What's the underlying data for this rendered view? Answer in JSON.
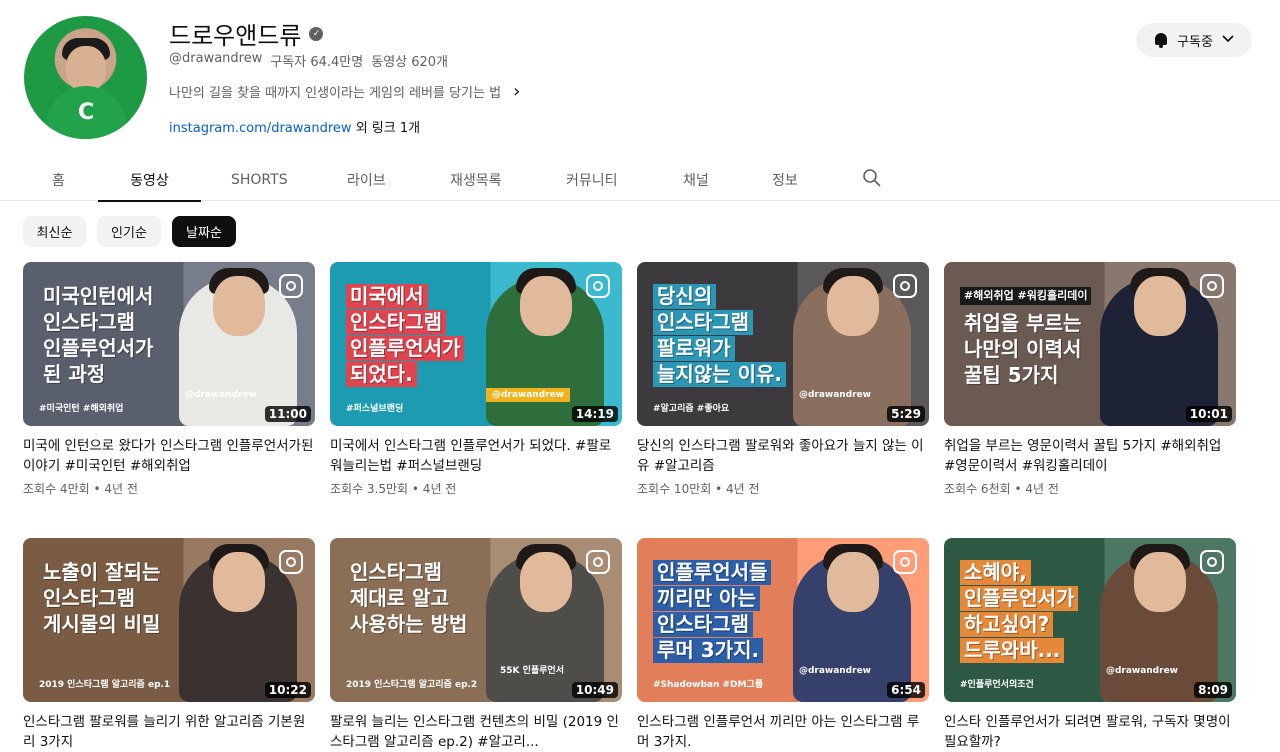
{
  "channel": {
    "name": "드로우앤드류",
    "handle": "@drawandrew",
    "subscribers": "구독자 64.4만명",
    "videos": "동영상 620개",
    "description": "나만의 길을 찾을 때까지 인생이라는 게임의 레버를 당기는 법",
    "link": "instagram.com/drawandrew",
    "link_more": "외 링크 1개",
    "avatar_text": "C",
    "subscribe_label": "구독중"
  },
  "tabs": [
    {
      "label": "홈"
    },
    {
      "label": "동영상"
    },
    {
      "label": "SHORTS"
    },
    {
      "label": "라이브"
    },
    {
      "label": "재생목록"
    },
    {
      "label": "커뮤니티"
    },
    {
      "label": "채널"
    },
    {
      "label": "정보"
    }
  ],
  "chips": [
    {
      "label": "최신순"
    },
    {
      "label": "인기순"
    },
    {
      "label": "날짜순"
    }
  ],
  "videos": [
    {
      "title": "미국에 인턴으로 왔다가 인스타그램 인플루언서가된 이야기 #미국인턴 #해외취업",
      "stats": "조회수 4만회 • 4년 전",
      "duration": "11:00",
      "lines": [
        "미국인턴에서",
        "인스타그램",
        "인플루언서가",
        "된 과정"
      ],
      "tag": "#미국인턴 #해외취업",
      "brand": "@drawandrew",
      "bg": "#5a5f6e",
      "hl": "transparent",
      "person": "#e8e8e4"
    },
    {
      "title": "미국에서 인스타그램 인플루언서가 되었다. #팔로워늘리는법 #퍼스널브랜딩",
      "stats": "조회수 3.5만회 • 4년 전",
      "duration": "14:19",
      "lines": [
        "미국에서",
        "인스타그램",
        "인플루언서가",
        "되었다."
      ],
      "tag": "#퍼스널브랜딩",
      "brand": "@drawandrew",
      "bg": "#1d9bb0",
      "hl": "#e0444f",
      "person": "#2d6e3a"
    },
    {
      "title": "당신의 인스타그램 팔로워와 좋아요가 늘지 않는 이유 #알고리즘",
      "stats": "조회수 10만회 • 4년 전",
      "duration": "5:29",
      "lines": [
        "당신의",
        "인스타그램",
        "팔로워가",
        "늘지않는 이유."
      ],
      "tag": "#알고리즘 #좋아요",
      "brand": "@drawandrew",
      "bg": "#3d3a3e",
      "hl": "#2b96b6",
      "person": "#8a6f5e"
    },
    {
      "title": "취업을 부르는 영문이력서 꿀팁 5가지 #해외취업 #영문이력서 #워킹홀리데이",
      "stats": "조회수 6천회 • 4년 전",
      "duration": "10:01",
      "lines": [
        "#해외취업 #워킹홀리데이",
        "취업을 부르는",
        "나만의 이력서",
        "꿀팁 5가지"
      ],
      "tag": "",
      "brand": "",
      "bg": "#6b5a52",
      "hl": "transparent",
      "person": "#1d2236"
    },
    {
      "title": "인스타그램 팔로워를 늘리기 위한 알고리즘 기본원리 3가지",
      "stats": "",
      "duration": "10:22",
      "lines": [
        "노출이 잘되는",
        "인스타그램",
        "게시물의 비밀"
      ],
      "tag": "2019 인스타그램 알고리즘 ep.1",
      "brand": "",
      "bg": "#7a5c44",
      "hl": "transparent",
      "person": "#3a3230"
    },
    {
      "title": "팔로워 늘리는 인스타그램 컨텐츠의 비밀 (2019 인스타그램 알고리즘 ep.2) #알고리...",
      "stats": "",
      "duration": "10:49",
      "lines": [
        "인스타그램",
        "제대로 알고",
        "사용하는 방법"
      ],
      "tag": "2019 인스타그램 알고리즘 ep.2",
      "brand": "55K 인플루언서",
      "bg": "#8a6e55",
      "hl": "transparent",
      "person": "#4f4d4a"
    },
    {
      "title": "인스타그램 인플루언서 끼리만 아는 인스타그램 루머 3가지.",
      "stats": "",
      "duration": "6:54",
      "lines": [
        "인플루언서들",
        "끼리만 아는",
        "인스타그램",
        "루머 3가지."
      ],
      "tag": "#Shadowban #DM그룹",
      "brand": "@drawandrew",
      "bg": "#e27f5a",
      "hl": "#2c5fa8",
      "person": "#35406b"
    },
    {
      "title": "인스타 인플루언서가 되려면 팔로워, 구독자 몇명이 필요할까?",
      "stats": "",
      "duration": "8:09",
      "lines": [
        "소혜야,",
        "인플루언서가",
        "하고싶어?",
        "드루와바..."
      ],
      "tag": "#인플루언서의조건",
      "brand": "@drawandrew",
      "bg": "#2e5a45",
      "hl": "#e5883a",
      "person": "#6a4b3a"
    }
  ]
}
